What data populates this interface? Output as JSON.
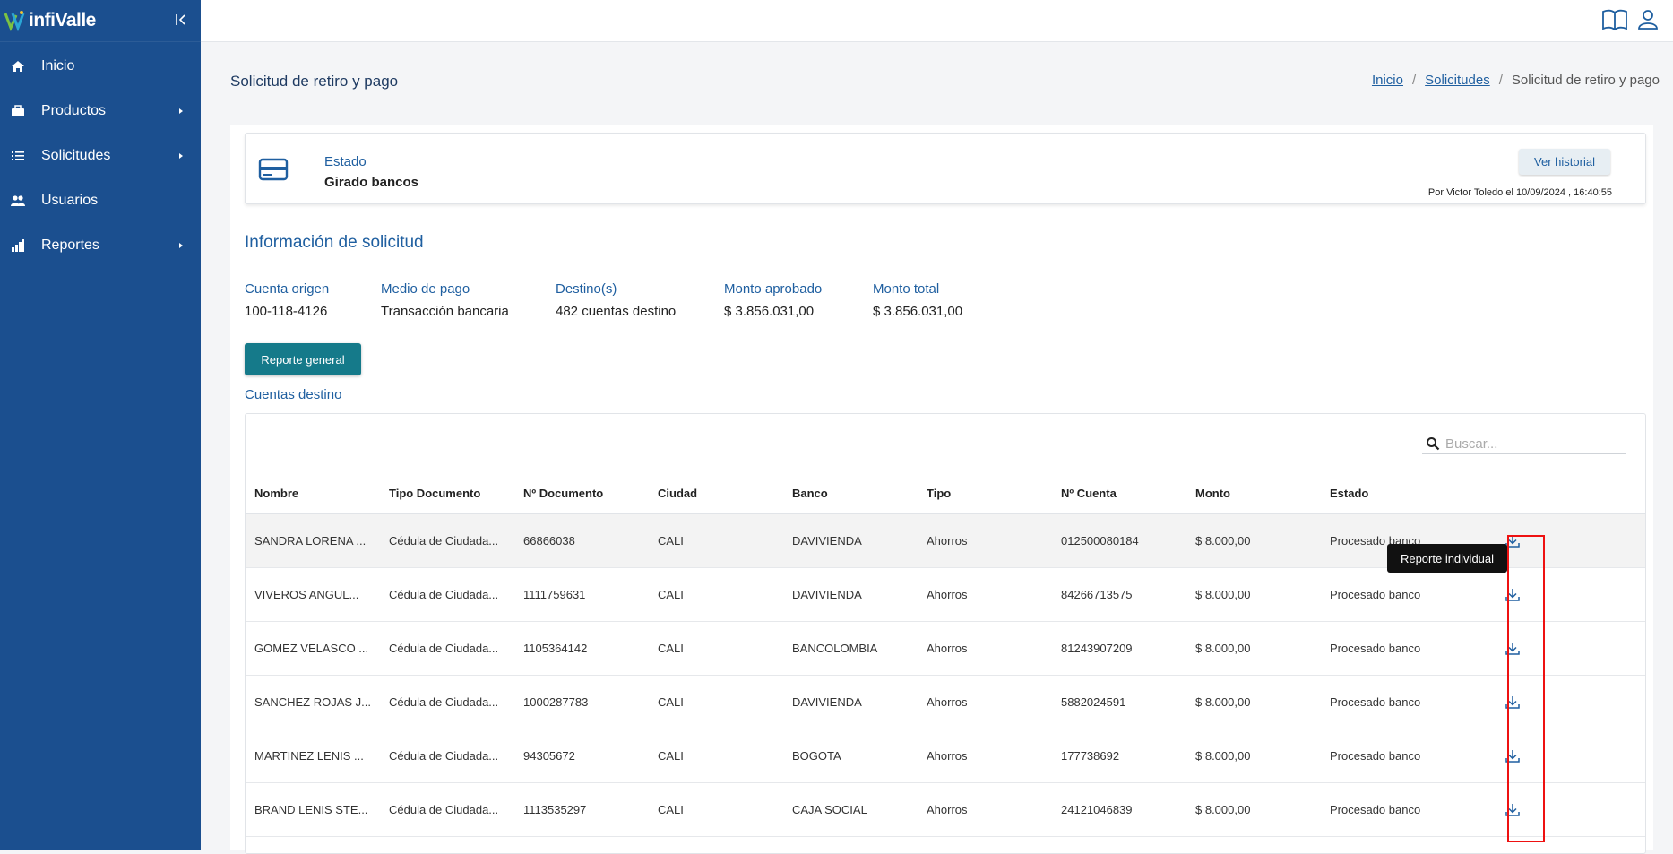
{
  "app": {
    "logo_text": "infiValle"
  },
  "sidebar": {
    "items": [
      {
        "label": "Inicio",
        "icon": "home-icon",
        "has_submenu": false
      },
      {
        "label": "Productos",
        "icon": "briefcase-icon",
        "has_submenu": true
      },
      {
        "label": "Solicitudes",
        "icon": "list-icon",
        "has_submenu": true
      },
      {
        "label": "Usuarios",
        "icon": "users-icon",
        "has_submenu": false
      },
      {
        "label": "Reportes",
        "icon": "bar-chart-icon",
        "has_submenu": true
      }
    ]
  },
  "topbar": {
    "icons": [
      "book-icon",
      "user-icon"
    ]
  },
  "page": {
    "title": "Solicitud de retiro y pago",
    "breadcrumb": [
      "Inicio",
      "Solicitudes",
      "Solicitud de retiro y pago"
    ]
  },
  "status": {
    "label": "Estado",
    "value": "Girado bancos",
    "history_button": "Ver historial",
    "meta": "Por Victor Toledo el 10/09/2024 , 16:40:55"
  },
  "info": {
    "title": "Información de solicitud",
    "fields": [
      {
        "label": "Cuenta origen",
        "value": "100-118-4126"
      },
      {
        "label": "Medio de pago",
        "value": "Transacción bancaria"
      },
      {
        "label": "Destino(s)",
        "value": "482 cuentas destino"
      },
      {
        "label": "Monto aprobado",
        "value": "$ 3.856.031,00"
      },
      {
        "label": "Monto total",
        "value": "$ 3.856.031,00"
      }
    ],
    "report_button": "Reporte general",
    "accounts_title": "Cuentas destino"
  },
  "table": {
    "search_placeholder": "Buscar...",
    "columns": [
      "Nombre",
      "Tipo Documento",
      "Nº Documento",
      "Ciudad",
      "Banco",
      "Tipo",
      "Nº Cuenta",
      "Monto",
      "Estado"
    ],
    "rows": [
      {
        "nombre": "SANDRA LORENA ...",
        "tipo_doc": "Cédula de Ciudada...",
        "doc": "66866038",
        "ciudad": "CALI",
        "banco": "DAVIVIENDA",
        "tipo": "Ahorros",
        "cuenta": "012500080184",
        "monto": "$ 8.000,00",
        "estado": "Procesado banco"
      },
      {
        "nombre": "VIVEROS ANGUL...",
        "tipo_doc": "Cédula de Ciudada...",
        "doc": "1111759631",
        "ciudad": "CALI",
        "banco": "DAVIVIENDA",
        "tipo": "Ahorros",
        "cuenta": "84266713575",
        "monto": "$ 8.000,00",
        "estado": "Procesado banco"
      },
      {
        "nombre": "GOMEZ VELASCO ...",
        "tipo_doc": "Cédula de Ciudada...",
        "doc": "1105364142",
        "ciudad": "CALI",
        "banco": "BANCOLOMBIA",
        "tipo": "Ahorros",
        "cuenta": "81243907209",
        "monto": "$ 8.000,00",
        "estado": "Procesado banco"
      },
      {
        "nombre": "SANCHEZ ROJAS J...",
        "tipo_doc": "Cédula de Ciudada...",
        "doc": "1000287783",
        "ciudad": "CALI",
        "banco": "DAVIVIENDA",
        "tipo": "Ahorros",
        "cuenta": "5882024591",
        "monto": "$ 8.000,00",
        "estado": "Procesado banco"
      },
      {
        "nombre": "MARTINEZ LENIS ...",
        "tipo_doc": "Cédula de Ciudada...",
        "doc": "94305672",
        "ciudad": "CALI",
        "banco": "BOGOTA",
        "tipo": "Ahorros",
        "cuenta": "177738692",
        "monto": "$ 8.000,00",
        "estado": "Procesado banco"
      },
      {
        "nombre": "BRAND LENIS STE...",
        "tipo_doc": "Cédula de Ciudada...",
        "doc": "1113535297",
        "ciudad": "CALI",
        "banco": "CAJA SOCIAL",
        "tipo": "Ahorros",
        "cuenta": "24121046839",
        "monto": "$ 8.000,00",
        "estado": "Procesado banco"
      }
    ],
    "tooltip": "Reporte individual"
  },
  "colors": {
    "sidebar": "#1b4f8f",
    "accent": "#1f5fa0",
    "primary_button": "#157a8a",
    "highlight": "#e11111"
  }
}
